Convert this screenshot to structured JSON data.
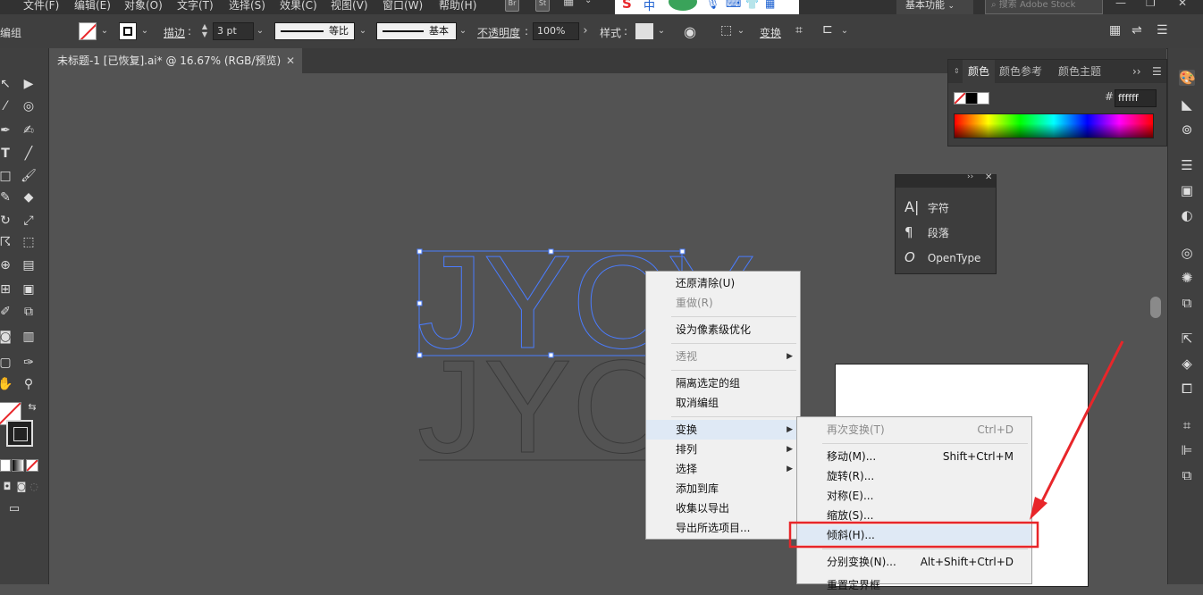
{
  "menubar": {
    "items": [
      "文件(F)",
      "编辑(E)",
      "对象(O)",
      "文字(T)",
      "选择(S)",
      "效果(C)",
      "视图(V)",
      "窗口(W)",
      "帮助(H)"
    ],
    "bridge": "Br",
    "stock": "St",
    "workspace": "基本功能",
    "search_placeholder": "搜索 Adobe Stock"
  },
  "control_bar": {
    "group_label": "编组",
    "stroke_label": "描边",
    "stroke_value": "3 pt",
    "profile_uniform": "等比",
    "brush_basic": "基本",
    "opacity_label": "不透明度",
    "opacity_value": "100%",
    "style_label": "样式",
    "transform_label": "变换"
  },
  "document": {
    "tab_title": "未标题-1 [已恢复].ai* @ 16.67% (RGB/预览)",
    "text": "JYCY"
  },
  "color_panel": {
    "tabs": [
      "颜色",
      "颜色参考",
      "颜色主题"
    ],
    "hex_label": "#",
    "hex_value": "ffffff"
  },
  "char_panel": {
    "items": [
      {
        "icon": "A|",
        "label": "字符"
      },
      {
        "icon": "¶",
        "label": "段落"
      },
      {
        "icon": "O",
        "label": "OpenType"
      }
    ]
  },
  "context_menu": {
    "items": [
      {
        "label": "还原清除(U)",
        "disabled": false,
        "submenu": false
      },
      {
        "label": "重做(R)",
        "disabled": true,
        "submenu": false
      },
      {
        "label": "设为像素级优化",
        "disabled": false,
        "submenu": false
      },
      {
        "label": "透视",
        "disabled": true,
        "submenu": true
      },
      {
        "label": "隔离选定的组",
        "disabled": false,
        "submenu": false
      },
      {
        "label": "取消编组",
        "disabled": false,
        "submenu": false
      },
      {
        "label": "变换",
        "disabled": false,
        "submenu": true,
        "highlighted": true
      },
      {
        "label": "排列",
        "disabled": false,
        "submenu": true
      },
      {
        "label": "选择",
        "disabled": false,
        "submenu": true
      },
      {
        "label": "添加到库",
        "disabled": false,
        "submenu": false
      },
      {
        "label": "收集以导出",
        "disabled": false,
        "submenu": true
      },
      {
        "label": "导出所选项目...",
        "disabled": false,
        "submenu": false
      }
    ]
  },
  "transform_submenu": {
    "items": [
      {
        "label": "再次变换(T)",
        "shortcut": "Ctrl+D",
        "disabled": true
      },
      {
        "label": "移动(M)...",
        "shortcut": "Shift+Ctrl+M",
        "disabled": false
      },
      {
        "label": "旋转(R)...",
        "shortcut": "",
        "disabled": false
      },
      {
        "label": "对称(E)...",
        "shortcut": "",
        "disabled": false
      },
      {
        "label": "缩放(S)...",
        "shortcut": "",
        "disabled": false
      },
      {
        "label": "倾斜(H)...",
        "shortcut": "",
        "disabled": false,
        "highlighted": true
      },
      {
        "label": "分别变换(N)...",
        "shortcut": "Alt+Shift+Ctrl+D",
        "disabled": false
      },
      {
        "label": "重置定界框",
        "shortcut": "",
        "disabled": false
      }
    ]
  },
  "colors": {
    "accent_selection": "#4a7cff",
    "annotation_red": "#e8262a",
    "menu_highlight": "#dfe9f5"
  }
}
